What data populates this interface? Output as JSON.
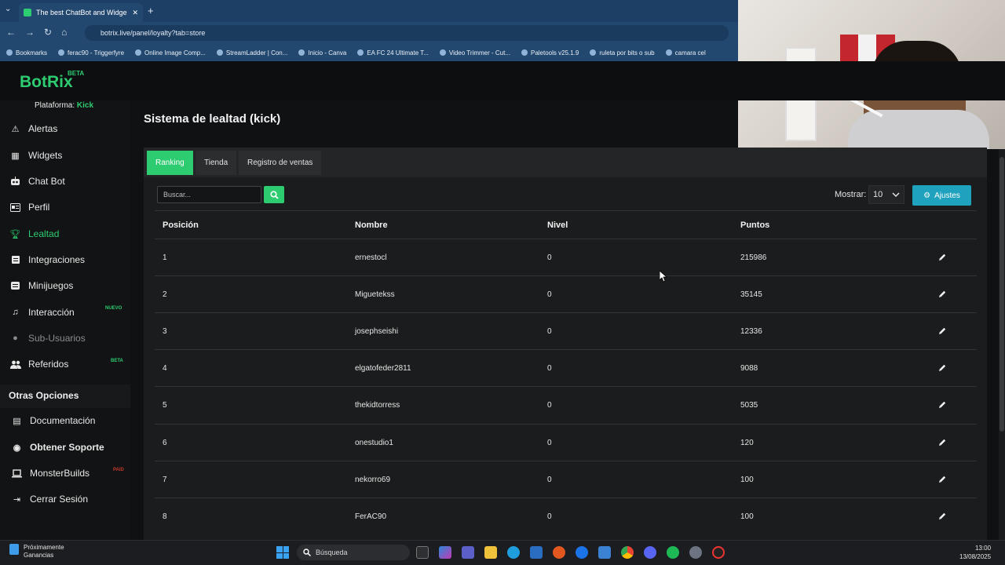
{
  "browser": {
    "tab_title": "The best ChatBot and Widgets",
    "url": "botrix.live/panel/loyalty?tab=store",
    "bookmarks": [
      "Bookmarks",
      "ferac90 - Triggerfyre",
      "Online Image Comp...",
      "StreamLadder | Con...",
      "Inicio - Canva",
      "EA FC 24 Ultimate T...",
      "Video Trimmer - Cut...",
      "Paletools v25.1.9",
      "ruleta por bits o sub",
      "camara cel"
    ]
  },
  "brand": {
    "name": "BotRix",
    "tag": "BETA",
    "accent": "#2ecc71"
  },
  "platform": {
    "label": "Plataforma:",
    "value": "Kick"
  },
  "sidebar": {
    "items": [
      {
        "label": "Alertas",
        "icon": "warning-icon"
      },
      {
        "label": "Widgets",
        "icon": "th-icon"
      },
      {
        "label": "Chat Bot",
        "icon": "robot-icon"
      },
      {
        "label": "Perfil",
        "icon": "id-card-icon"
      },
      {
        "label": "Lealtad",
        "icon": "trophy-icon"
      },
      {
        "label": "Integraciones",
        "icon": "plug-icon"
      },
      {
        "label": "Minijuegos",
        "icon": "gamepad-icon"
      },
      {
        "label": "Interacción",
        "icon": "music-icon",
        "badge": "NUEVO"
      },
      {
        "label": "Sub-Usuarios",
        "icon": "users-icon"
      },
      {
        "label": "Referidos",
        "icon": "users-icon",
        "badge": "BETA"
      }
    ],
    "section_title": "Otras Opciones",
    "other": [
      {
        "label": "Documentación",
        "icon": "book-icon"
      },
      {
        "label": "Obtener Soporte",
        "icon": "support-icon"
      },
      {
        "label": "MonsterBuilds",
        "icon": "laptop-icon",
        "badge": "PAID"
      },
      {
        "label": "Cerrar Sesión",
        "icon": "sign-out-icon"
      }
    ]
  },
  "page": {
    "title": "Sistema de lealtad (kick)"
  },
  "tabs": [
    "Ranking",
    "Tienda",
    "Registro de ventas"
  ],
  "search": {
    "placeholder": "Buscar..."
  },
  "controls": {
    "show_label": "Mostrar:",
    "show_value": "10",
    "settings_label": "Ajustes"
  },
  "table": {
    "headers": [
      "Posición",
      "Nombre",
      "Nivel",
      "Puntos"
    ],
    "rows": [
      {
        "pos": "1",
        "name": "ernestocl",
        "level": "0",
        "points": "215986"
      },
      {
        "pos": "2",
        "name": "Miguetekss",
        "level": "0",
        "points": "35145"
      },
      {
        "pos": "3",
        "name": "josephseishi",
        "level": "0",
        "points": "12336"
      },
      {
        "pos": "4",
        "name": "elgatofeder2811",
        "level": "0",
        "points": "9088"
      },
      {
        "pos": "5",
        "name": "thekidtorress",
        "level": "0",
        "points": "5035"
      },
      {
        "pos": "6",
        "name": "onestudio1",
        "level": "0",
        "points": "120"
      },
      {
        "pos": "7",
        "name": "nekorro69",
        "level": "0",
        "points": "100"
      },
      {
        "pos": "8",
        "name": "FerAC90",
        "level": "0",
        "points": "100"
      }
    ]
  },
  "taskbar": {
    "weather_line1": "Próximamente",
    "weather_line2": "Ganancias",
    "search": "Búsqueda",
    "time": "13:00",
    "date": "13/08/2025"
  }
}
